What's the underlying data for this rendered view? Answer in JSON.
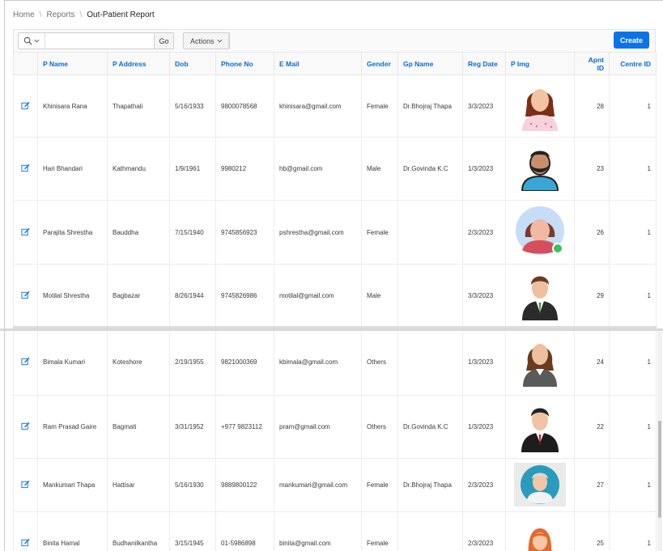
{
  "breadcrumb": {
    "items": [
      "Home",
      "Reports"
    ],
    "current": "Out-Patient Report"
  },
  "toolbar": {
    "search_value": "",
    "go_label": "Go",
    "actions_label": "Actions",
    "create_label": "Create"
  },
  "columns": [
    "P Name",
    "P Address",
    "Dob",
    "Phone No",
    "E Mail",
    "Gender",
    "Gp Name",
    "Reg Date",
    "P Img",
    "Apnt ID",
    "Centre ID"
  ],
  "rows": [
    {
      "name": "Khinisara Rana",
      "address": "Thapathali",
      "dob": "5/16/1933",
      "phone": "9800078568",
      "email": "khinisara@gmail.com",
      "gender": "Female",
      "gp": "Dr.Bhojraj Thapa",
      "reg": "3/3/2023",
      "img": "female-patient-avatar",
      "apnt": "28",
      "centre": "1"
    },
    {
      "name": "Hari Bhandari",
      "address": "Kathmandu",
      "dob": "1/9/1961",
      "phone": "9980212",
      "email": "hb@gmail.com",
      "gender": "Male",
      "gp": "Dr.Govinda K.C",
      "reg": "1/3/2023",
      "img": "bearded-male-avatar",
      "apnt": "23",
      "centre": "1"
    },
    {
      "name": "Parajita Shrestha",
      "address": "Bauddha",
      "dob": "7/15/1940",
      "phone": "9745856923",
      "email": "pshrestha@gmail.com",
      "gender": "Female",
      "gp": "",
      "reg": "2/3/2023",
      "img": "female-online-avatar",
      "apnt": "26",
      "centre": "1"
    },
    {
      "name": "Motilal Shrestha",
      "address": "Bagbazar",
      "dob": "8/26/1944",
      "phone": "9745826986",
      "email": "motilal@gmail.com",
      "gender": "Male",
      "gp": "",
      "reg": "3/3/2023",
      "img": "businessman-avatar",
      "apnt": "29",
      "centre": "1"
    },
    {
      "name": "Bimala Kumari",
      "address": "Koteshore",
      "dob": "2/19/1955",
      "phone": "9821000369",
      "email": "kbimala@gmail.com",
      "gender": "Others",
      "gp": "",
      "reg": "1/3/2023",
      "img": "businesswoman-avatar",
      "apnt": "24",
      "centre": "1"
    },
    {
      "name": "Ram Prasad Gaire",
      "address": "Bagmati",
      "dob": "3/31/1952",
      "phone": "+977 9823112",
      "email": "pram@gmail.com",
      "gender": "Others",
      "gp": "Dr.Govinda K.C",
      "reg": "1/3/2023",
      "img": "suited-man-avatar",
      "apnt": "22",
      "centre": "1"
    },
    {
      "name": "Mankumari Thapa",
      "address": "Hattisar",
      "dob": "5/16/1930",
      "phone": "9889800122",
      "email": "mankumari@gmail.com",
      "gender": "Female",
      "gp": "Dr.Bhojraj Thapa",
      "reg": "2/3/2023",
      "img": "elderly-avatar",
      "apnt": "27",
      "centre": "1"
    },
    {
      "name": "Binita Hamal",
      "address": "Budhanilkantha",
      "dob": "3/15/1945",
      "phone": "01-5986898",
      "email": "binita@gmail.com",
      "gender": "Female",
      "gp": "",
      "reg": "2/3/2023",
      "img": "redhead-female-avatar",
      "apnt": "25",
      "centre": "1"
    }
  ],
  "colors": {
    "accent": "#0b73e8",
    "header_text": "#0a6bd6"
  }
}
